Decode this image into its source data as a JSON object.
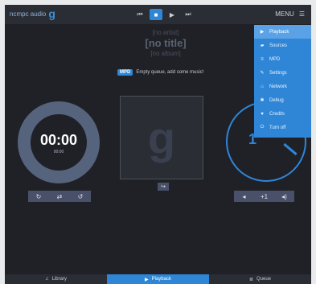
{
  "app": {
    "title": "ncmpc audio",
    "logo_mark": "g"
  },
  "header": {
    "menu_label": "MENU",
    "transport_icons": [
      "prev-icon",
      "stop-icon",
      "play-icon",
      "next-icon"
    ]
  },
  "now_playing": {
    "artist": "[no artist]",
    "title": "[no title]",
    "album": "[no album]",
    "status_tag": "MPD",
    "status_text": "Empty queue, add some music!"
  },
  "player": {
    "time": "00:00",
    "time_small": "00:00",
    "volume_label": "1"
  },
  "controls": {
    "left": [
      "↻",
      "⇄",
      "↺"
    ],
    "right": [
      "◂",
      "+1",
      "◂)"
    ]
  },
  "footer": {
    "tabs": [
      "Library",
      "Playback",
      "Queue"
    ]
  },
  "menu": {
    "items": [
      {
        "label": "Playback",
        "icon": "▶"
      },
      {
        "label": "Sources",
        "icon": "▰"
      },
      {
        "label": "MPD",
        "icon": "≡"
      },
      {
        "label": "Settings",
        "icon": "✎"
      },
      {
        "label": "Network",
        "icon": "⌂"
      },
      {
        "label": "Debug",
        "icon": "✱"
      },
      {
        "label": "Credits",
        "icon": "♥"
      },
      {
        "label": "Turn off",
        "icon": "⏻"
      }
    ],
    "active_index": 0
  },
  "colors": {
    "accent": "#2f86d6",
    "background": "#1f2127",
    "timer_ring": "#55637c"
  }
}
